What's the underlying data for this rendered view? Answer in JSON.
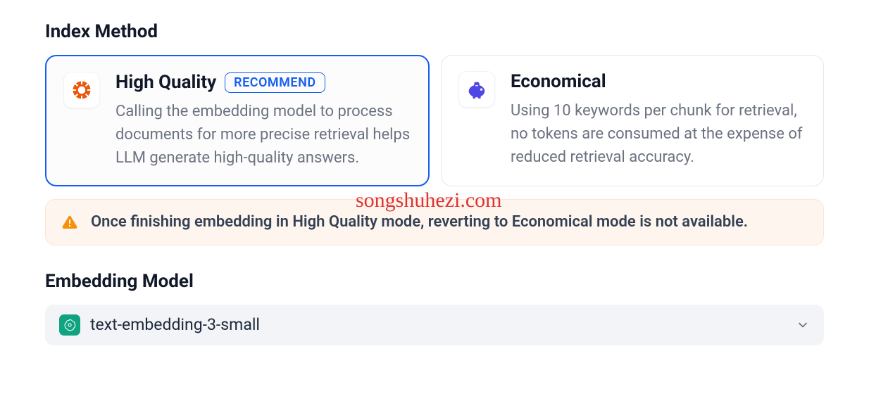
{
  "index_method": {
    "title": "Index Method",
    "options": {
      "high_quality": {
        "name": "High Quality",
        "badge": "RECOMMEND",
        "description": "Calling the embedding model to process documents for more precise retrieval helps LLM generate high-quality answers."
      },
      "economical": {
        "name": "Economical",
        "description": "Using 10 keywords per chunk for retrieval, no tokens are consumed at the expense of reduced retrieval accuracy."
      }
    },
    "warning": "Once finishing embedding in High Quality mode, reverting to Economical mode is not available."
  },
  "embedding_model": {
    "title": "Embedding Model",
    "selected": "text-embedding-3-small"
  },
  "watermark": "songshuhezi.com"
}
